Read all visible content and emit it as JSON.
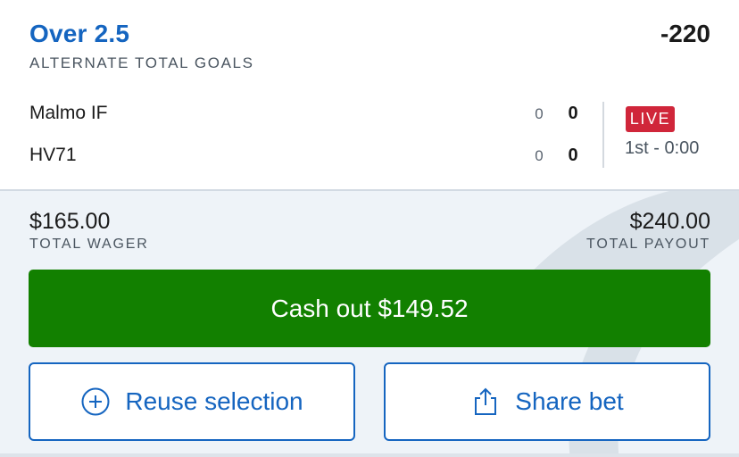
{
  "bet": {
    "selection": "Over 2.5",
    "odds": "-220",
    "market": "ALTERNATE TOTAL GOALS"
  },
  "event": {
    "teams": [
      {
        "name": "Malmo IF",
        "period_score": "0",
        "total_score": "0"
      },
      {
        "name": "HV71",
        "period_score": "0",
        "total_score": "0"
      }
    ],
    "live_badge": "LIVE",
    "period_clock": "1st - 0:00"
  },
  "summary": {
    "wager_amount": "$165.00",
    "wager_label": "TOTAL WAGER",
    "payout_amount": "$240.00",
    "payout_label": "TOTAL PAYOUT"
  },
  "actions": {
    "cashout_label": "Cash out $149.52",
    "reuse_label": "Reuse selection",
    "reuse_icon": "plus-circle-icon",
    "share_label": "Share bet",
    "share_icon": "share-icon"
  },
  "colors": {
    "title_blue": "#1565c0",
    "live_red": "#d0263a",
    "cashout_green": "#128000",
    "panel_bg": "#eef3f8"
  }
}
